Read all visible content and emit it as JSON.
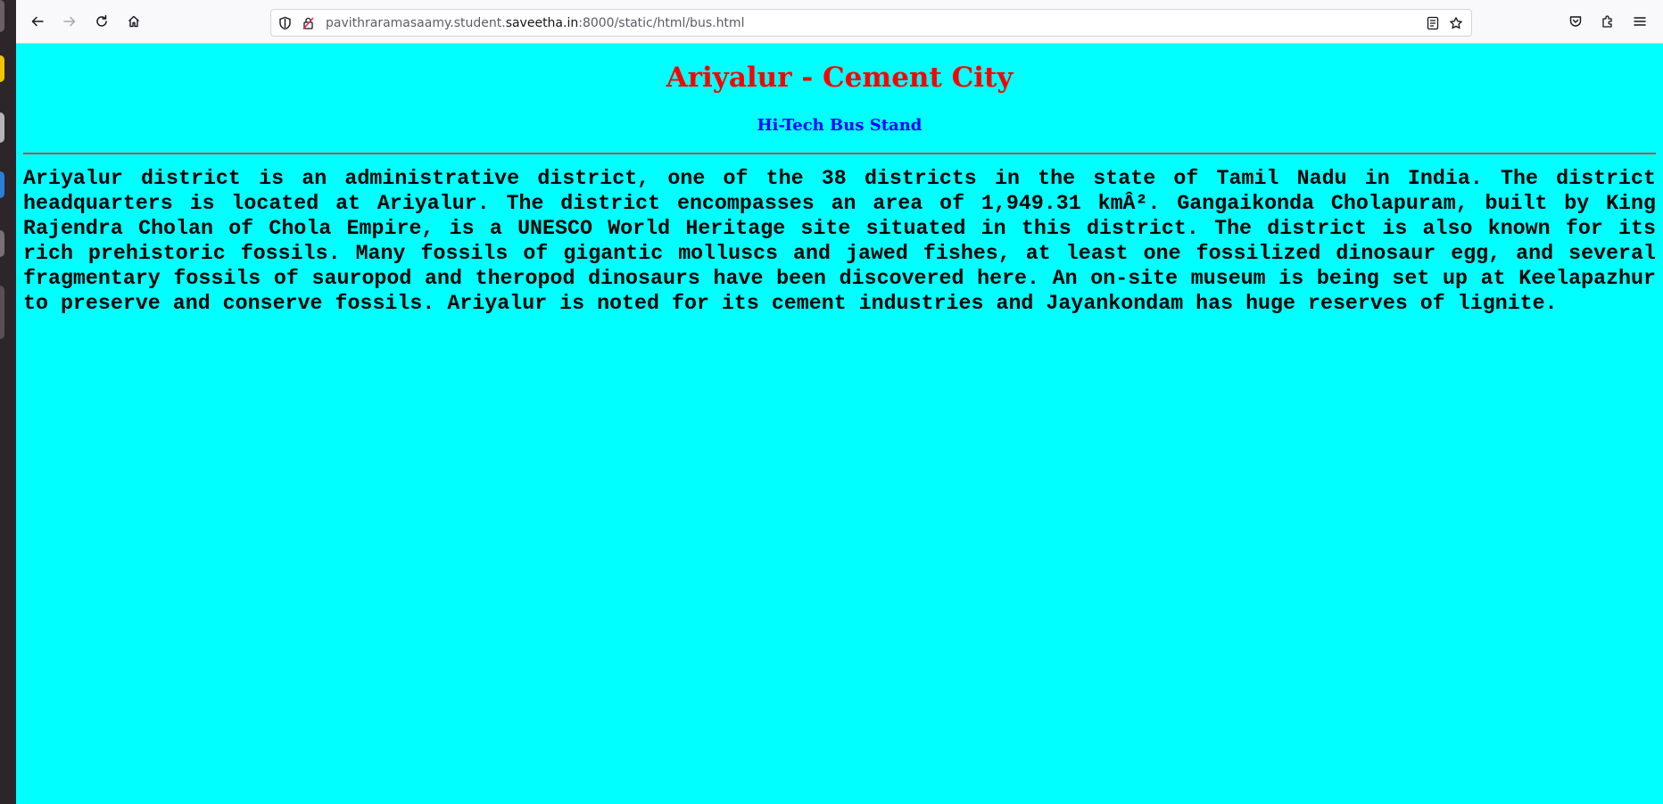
{
  "browser": {
    "url_prefix": "pavithraramasaamy.student.",
    "url_host": "saveetha.in",
    "url_suffix": ":8000/static/html/bus.html"
  },
  "page": {
    "title": "Ariyalur - Cement City",
    "subtitle": "Hi-Tech Bus Stand",
    "paragraph": "Ariyalur district is an administrative district, one of the 38 districts in the state of Tamil Nadu in India. The district headquarters is located at Ariyalur. The district encompasses an area of 1,949.31 kmÂ². Gangaikonda Cholapuram, built by King Rajendra Cholan of Chola Empire, is a UNESCO World Heritage site situated in this district. The district is also known for its rich prehistoric fossils. Many fossils of gigantic molluscs and jawed fishes, at least one fossilized dinosaur egg, and several fragmentary fossils of sauropod and theropod dinosaurs have been discovered here. An on-site museum is being set up at Keelapazhur to preserve and conserve fossils. Ariyalur is noted for its cement industries and Jayankondam has huge reserves of lignite."
  },
  "colors": {
    "background": "#00ffff",
    "title": "#ff0000",
    "subtitle": "#0000ff",
    "rule": "#c84a4a"
  }
}
